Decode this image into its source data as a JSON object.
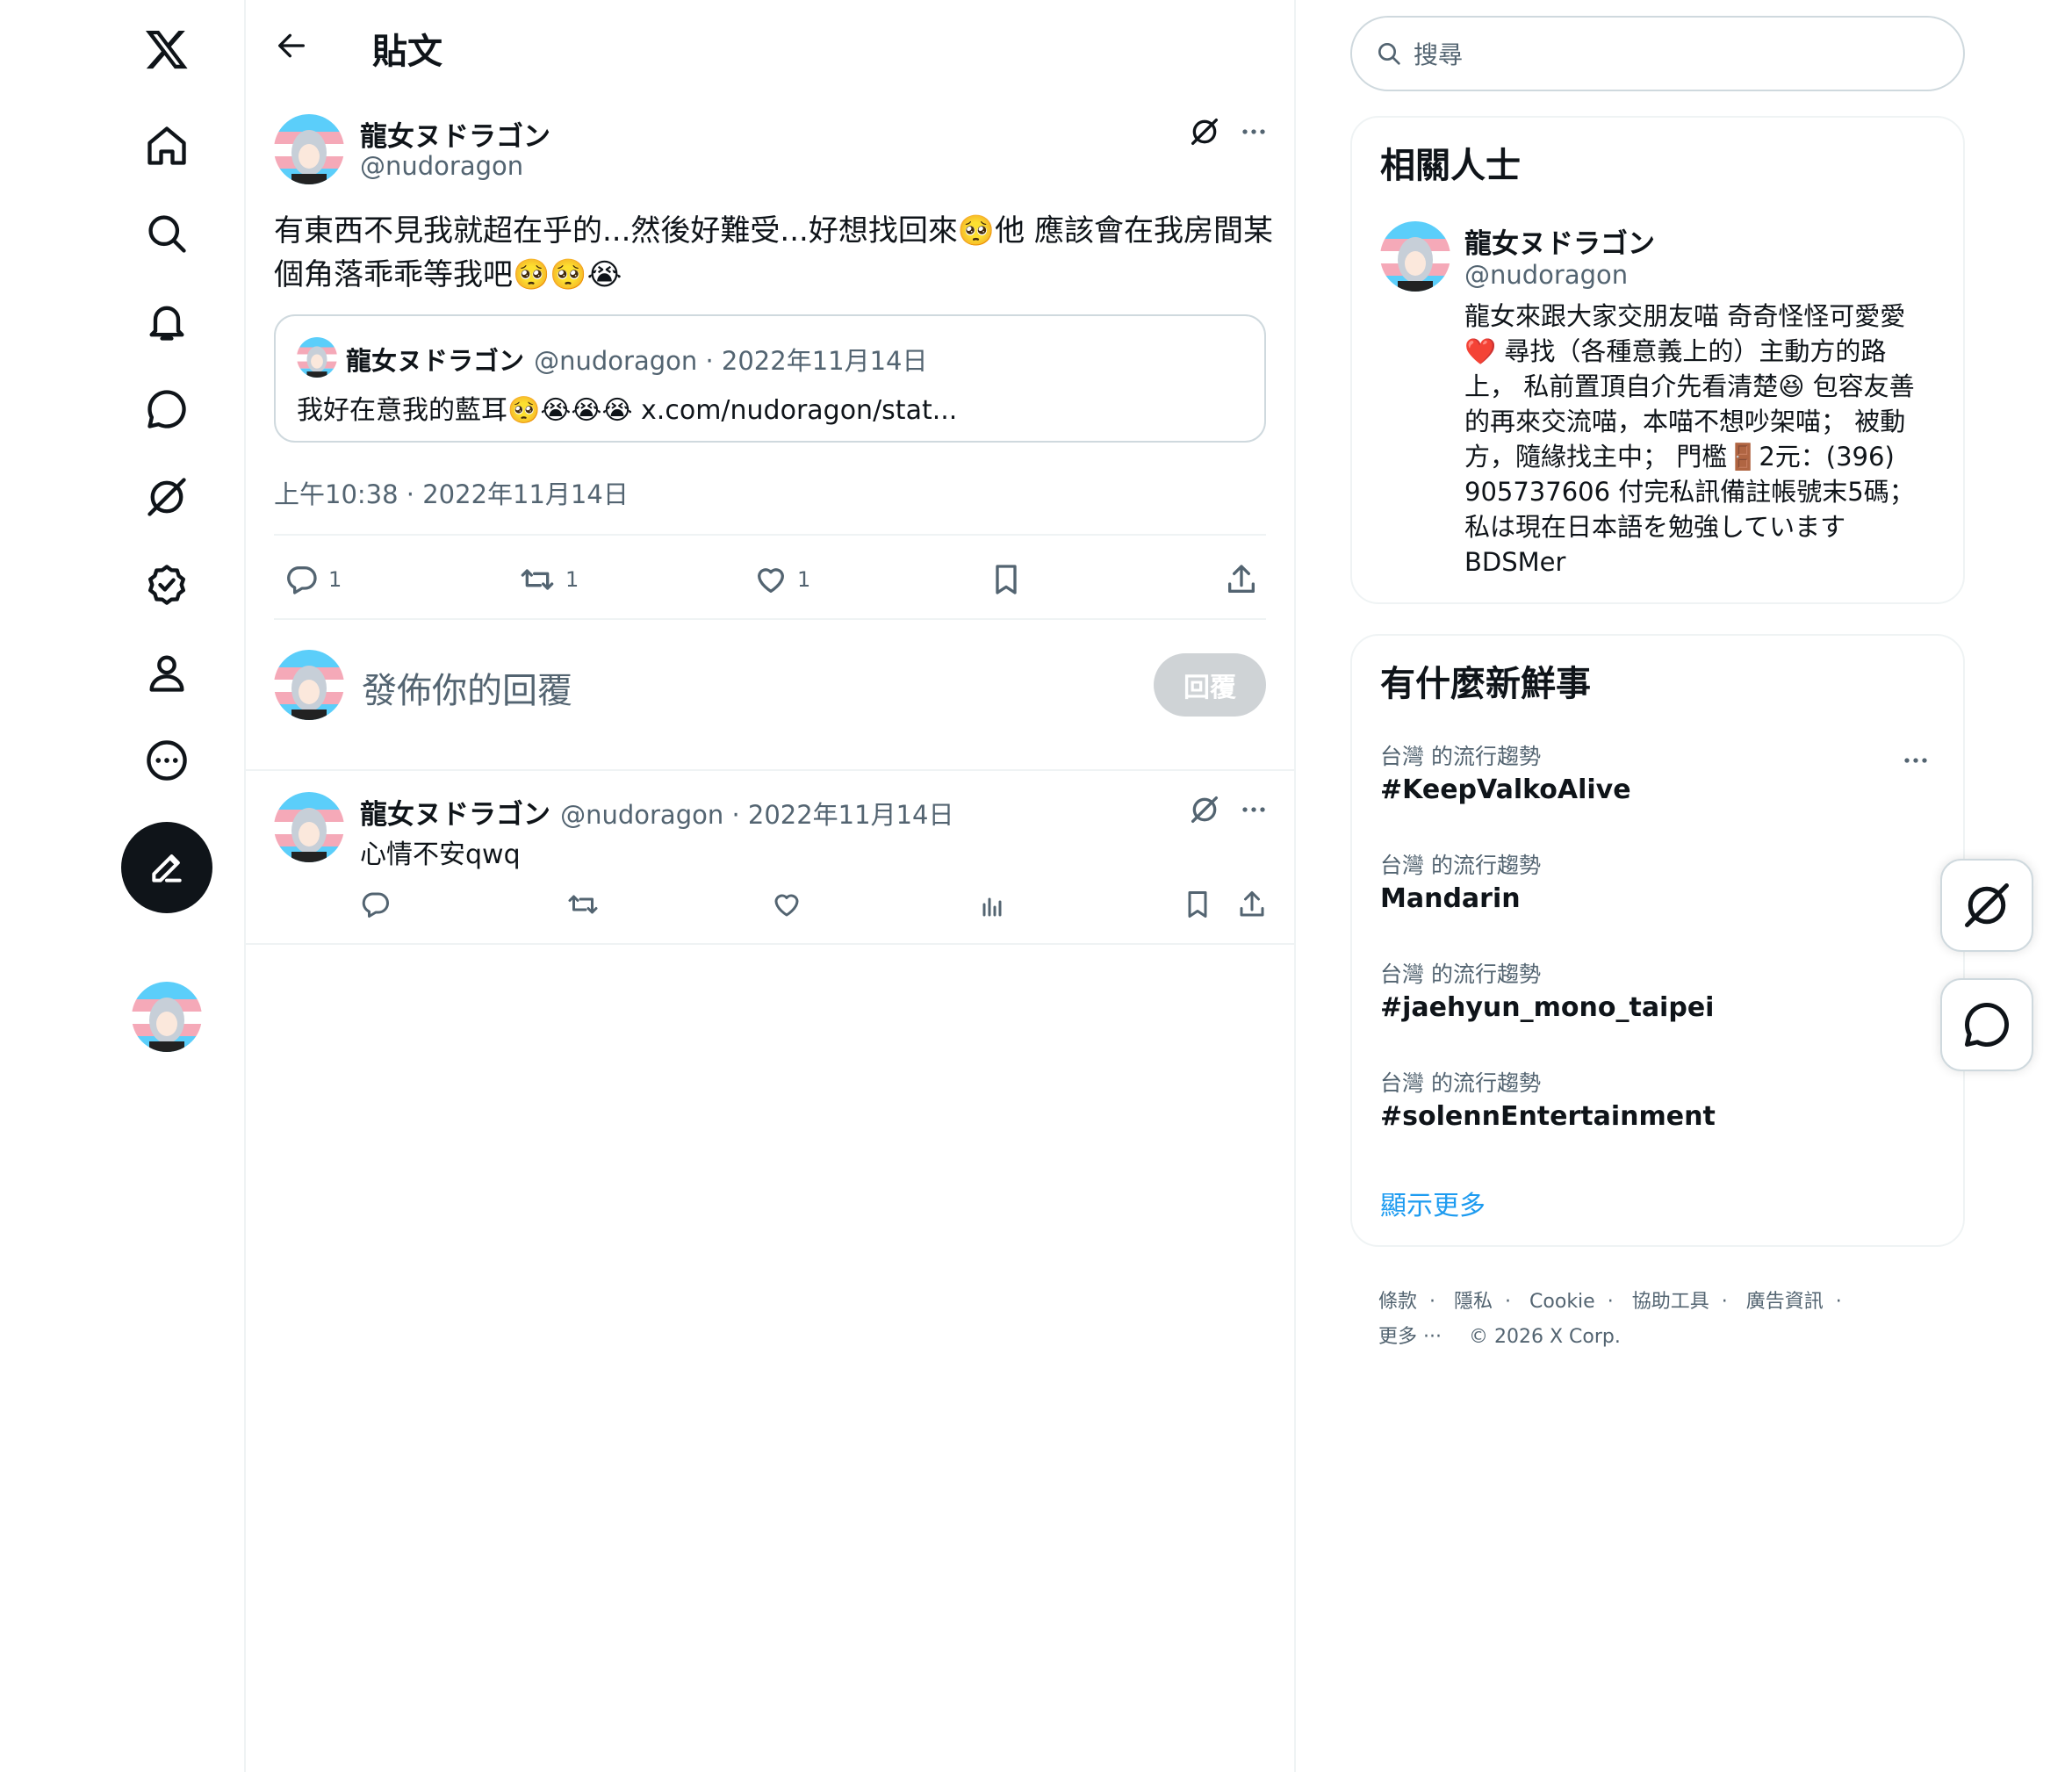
{
  "header": {
    "title": "貼文"
  },
  "post": {
    "name": "龍女ヌドラゴン",
    "handle": "@nudoragon",
    "text_line1": "有東西不見我就超在乎的...然後好難受...好想找回來🥺他 應該會在我房間某",
    "text_line2": "個角落乖乖等我吧🥺🥺😭",
    "quote": {
      "name": "龍女ヌドラゴン",
      "meta": "@nudoragon · 2022年11月14日",
      "text": "我好在意我的藍耳🥺😭😭😭 x.com/nudoragon/stat..."
    },
    "timestamp": "上午10:38 · 2022年11月14日",
    "stats": {
      "replies": "1",
      "retweets": "1",
      "likes": "1"
    }
  },
  "reply_box": {
    "placeholder": "發佈你的回覆",
    "button": "回覆"
  },
  "reply": {
    "name": "龍女ヌドラゴン",
    "meta": "@nudoragon · 2022年11月14日",
    "text": "心情不安qwq"
  },
  "search": {
    "placeholder": "搜尋"
  },
  "related": {
    "title": "相關人士",
    "name": "龍女ヌドラゴン",
    "handle": "@nudoragon",
    "bio": [
      "龍女來跟大家交朋友喵 奇奇怪怪可愛愛",
      "❤️ 尋找（各種意義上的）主動方的路",
      "上， 私前置頂自介先看清楚😆 包容友善",
      "的再來交流喵，本喵不想吵架喵； 被動",
      "方，隨緣找主中； 門檻🚪2元：(396)",
      "905737606 付完私訊備註帳號末5碼；",
      "私は現在日本語を勉強しています",
      "BDSMer"
    ]
  },
  "trends": {
    "title": "有什麼新鮮事",
    "items": [
      {
        "category": "台灣 的流行趨勢",
        "name": "#KeepValkoAlive"
      },
      {
        "category": "台灣 的流行趨勢",
        "name": "Mandarin"
      },
      {
        "category": "台灣 的流行趨勢",
        "name": "#jaehyun_mono_taipei"
      },
      {
        "category": "台灣 的流行趨勢",
        "name": "#solennEntertainment"
      }
    ],
    "show_more": "顯示更多"
  },
  "footer": {
    "links": [
      "條款",
      "隱私",
      "Cookie",
      "協助工具",
      "廣告資訊"
    ],
    "more": "更多 ···",
    "copyright": "© 2026 X Corp."
  },
  "colors": {
    "accent": "#1d9bf0",
    "text": "#0f1419",
    "secondary": "#536471",
    "border": "#eff3f4"
  }
}
